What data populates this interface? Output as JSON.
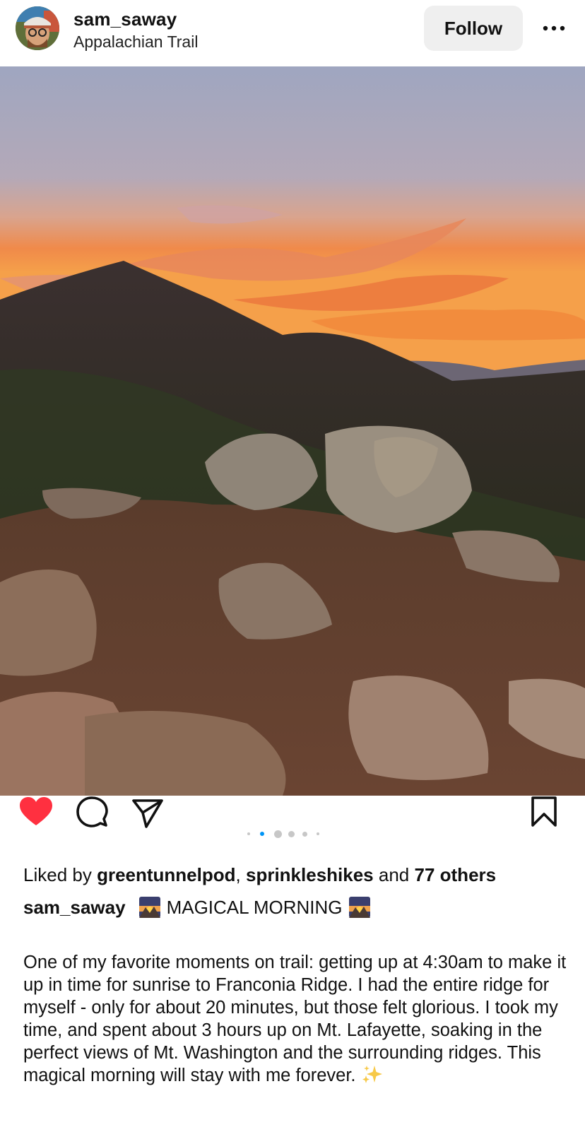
{
  "post": {
    "username": "sam_saway",
    "location": "Appalachian Trail",
    "follow_label": "Follow"
  },
  "carousel": {
    "dot_count": 6,
    "active_index": 1
  },
  "likes": {
    "prefix": "Liked by",
    "user1": "greentunnelpod",
    "separator": ",",
    "user2": "sprinkleshikes",
    "conjunction": "and",
    "others": "77 others"
  },
  "caption": {
    "username": "sam_saway",
    "title": "MAGICAL MORNING",
    "body": "One of my favorite moments on trail: getting up at 4:30am to make it up in time for sunrise to Franconia Ridge. I had the entire ridge for myself - only for about 20 minutes, but those felt glorious. I took my time, and spent about 3 hours up on Mt. Lafayette, soaking in the perfect views of Mt. Washington and the surrounding ridges. This magical morning will stay with me forever."
  },
  "icons": {
    "more": "more-options-icon",
    "like": "heart-icon",
    "comment": "comment-icon",
    "share": "send-icon",
    "save": "bookmark-icon",
    "title_emoji": "sunrise-over-mountains-emoji",
    "sparkle_emoji": "sparkles-emoji"
  },
  "colors": {
    "like_red": "#ff3040",
    "carousel_active": "#0095f6",
    "carousel_inactive": "#c7c7c7",
    "follow_bg": "#efefef"
  }
}
